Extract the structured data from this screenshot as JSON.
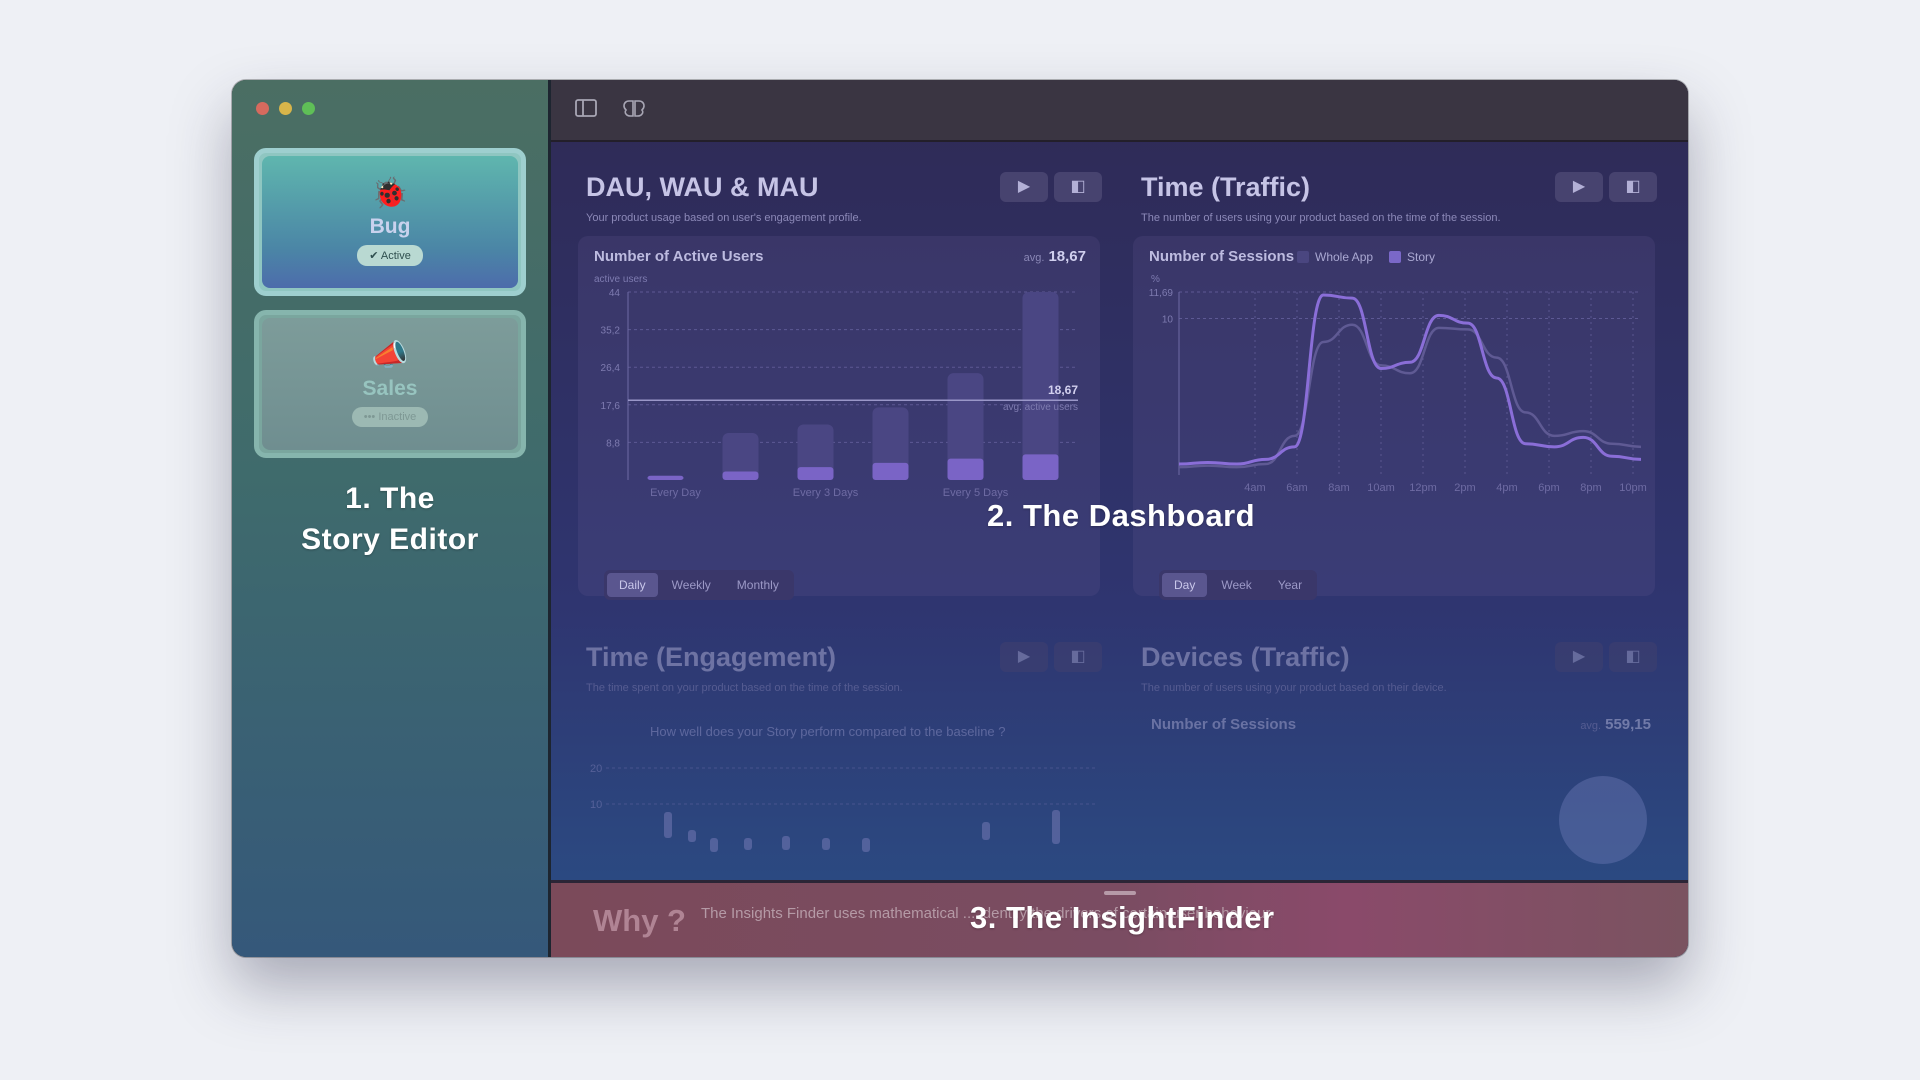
{
  "sidebar": {
    "stories": [
      {
        "name": "Bug",
        "icon": "🐞",
        "status": "✔ Active"
      },
      {
        "name": "Sales",
        "icon": "📣",
        "status": "••• Inactive"
      }
    ]
  },
  "overlays": {
    "label1": "1. The\nStory Editor",
    "label2": "2. The Dashboard",
    "label3": "3. The InsightFinder"
  },
  "panels": {
    "dau": {
      "title": "DAU, WAU & MAU",
      "subtitle": "Your product usage based on user's engagement profile.",
      "card_title": "Number of Active Users",
      "avg_label": "avg.",
      "avg_value": "18,67",
      "ref_value": "18,67",
      "ref_label": "avg. active users",
      "y_axis_label": "active users",
      "tabs": [
        "Daily",
        "Weekly",
        "Monthly"
      ]
    },
    "traffic": {
      "title": "Time (Traffic)",
      "subtitle": "The number of users using your product based on the time of the session.",
      "card_title": "Number of Sessions",
      "legend": [
        "Whole App",
        "Story"
      ],
      "y_unit": "%",
      "tabs": [
        "Day",
        "Week",
        "Year"
      ]
    },
    "engagement": {
      "title": "Time (Engagement)",
      "subtitle": "The time spent on your product based on the time of the session.",
      "question": "How well does your Story perform compared to the baseline ?"
    },
    "devices": {
      "title": "Devices (Traffic)",
      "subtitle": "The number of users using your product based on their device.",
      "card_title": "Number of Sessions",
      "avg_label": "avg.",
      "avg_value": "559,15"
    }
  },
  "insight": {
    "why": "Why ?",
    "text": "The Insights Finder uses mathematical ... identify the drivers of certain user behaviour."
  },
  "chart_data": [
    {
      "type": "bar",
      "title": "Number of Active Users",
      "ylabel": "active users",
      "yticks": [
        "44",
        "35,2",
        "26,4",
        "17,6",
        "8,8"
      ],
      "ylim": [
        0,
        44
      ],
      "xticks": [
        "Every Day",
        "Every 3 Days",
        "Every 5 Days"
      ],
      "series": [
        {
          "name": "total",
          "values": [
            1,
            11,
            13,
            17,
            25,
            44
          ]
        },
        {
          "name": "story",
          "values": [
            1,
            2,
            3,
            4,
            5,
            6
          ]
        }
      ],
      "reference_line": {
        "value": 18.67,
        "label": "avg. active users"
      }
    },
    {
      "type": "line",
      "title": "Number of Sessions",
      "ylabel": "%",
      "yticks": [
        "11,69",
        "10"
      ],
      "ylim": [
        0,
        11.69
      ],
      "x": [
        "4am",
        "6am",
        "8am",
        "10am",
        "12pm",
        "2pm",
        "4pm",
        "6pm",
        "8pm",
        "10pm"
      ],
      "series": [
        {
          "name": "Whole App",
          "values": [
            0.5,
            0.6,
            0.5,
            0.7,
            2.5,
            8.5,
            9.6,
            7.0,
            6.5,
            9.4,
            9.3,
            7.5,
            4.0,
            2.5,
            2.8,
            2.0,
            1.8
          ]
        },
        {
          "name": "Story",
          "values": [
            0.7,
            0.8,
            0.7,
            1.0,
            1.8,
            11.5,
            11.3,
            6.8,
            7.2,
            10.2,
            9.7,
            6.2,
            2.0,
            1.8,
            2.4,
            1.2,
            1.0
          ]
        }
      ]
    }
  ]
}
